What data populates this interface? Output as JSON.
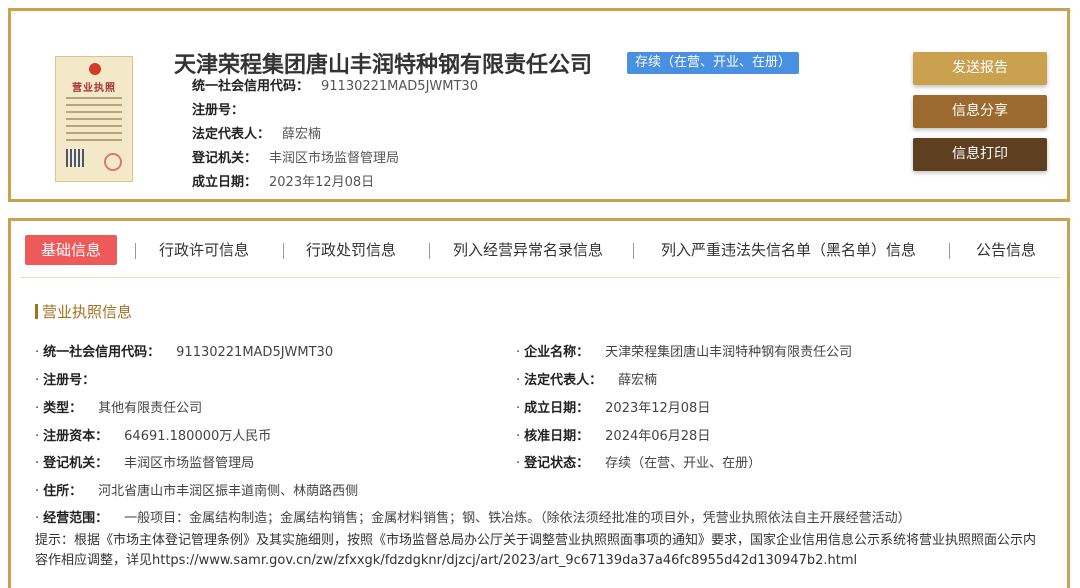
{
  "company": {
    "name": "天津荣程集团唐山丰润特种钢有限责任公司",
    "status": "存续（在营、开业、在册）",
    "license_title": "营业执照"
  },
  "summary": [
    {
      "label": "统一社会信用代码：",
      "value": "91130221MAD5JWMT30"
    },
    {
      "label": "注册号：",
      "value": ""
    },
    {
      "label": "法定代表人：",
      "value": "薛宏楠"
    },
    {
      "label": "登记机关：",
      "value": "丰润区市场监督管理局"
    },
    {
      "label": "成立日期：",
      "value": "2023年12月08日"
    }
  ],
  "actions": {
    "send_report": "发送报告",
    "share": "信息分享",
    "print": "信息打印"
  },
  "tabs": [
    {
      "label": "基础信息",
      "active": true
    },
    {
      "label": "行政许可信息"
    },
    {
      "label": "行政处罚信息"
    },
    {
      "label": "列入经营异常名录信息"
    },
    {
      "label": "列入严重违法失信名单（黑名单）信息"
    },
    {
      "label": "公告信息"
    }
  ],
  "section": {
    "title": "营业执照信息"
  },
  "details_left": [
    {
      "label": "统一社会信用代码：",
      "value": "91130221MAD5JWMT30"
    },
    {
      "label": "注册号：",
      "value": ""
    },
    {
      "label": "类型：",
      "value": "其他有限责任公司"
    },
    {
      "label": "注册资本：",
      "value": "64691.180000万人民币"
    },
    {
      "label": "登记机关：",
      "value": "丰润区市场监督管理局"
    },
    {
      "label": "住所：",
      "value": "河北省唐山市丰润区振丰道南侧、林荫路西侧"
    },
    {
      "label": "经营范围：",
      "value": "一般项目：金属结构制造；金属结构销售；金属材料销售；钢、铁冶炼。（除依法须经批准的项目外，凭营业执照依法自主开展经营活动）"
    }
  ],
  "details_right": [
    {
      "label": "企业名称：",
      "value": "天津荣程集团唐山丰润特种钢有限责任公司"
    },
    {
      "label": "法定代表人：",
      "value": "薛宏楠"
    },
    {
      "label": "成立日期：",
      "value": "2023年12月08日"
    },
    {
      "label": "核准日期：",
      "value": "2024年06月28日"
    },
    {
      "label": "登记状态：",
      "value": "存续（在营、开业、在册）"
    }
  ],
  "hint": "提示：根据《市场主体登记管理条例》及其实施细则，按照《市场监督总局办公厅关于调整营业执照照面事项的通知》要求，国家企业信用信息公示系统将营业执照照面公示内容作相应调整，详见https://www.samr.gov.cn/zw/zfxxgk/fdzdgknr/djzcj/art/2023/art_9c67139da37a46fc8955d42d130947b2.html",
  "colors": {
    "gold_border": "#c9a14f",
    "status_blue": "#4a90e2",
    "active_tab": "#ee5a5a",
    "section_brown": "#a4711f"
  }
}
